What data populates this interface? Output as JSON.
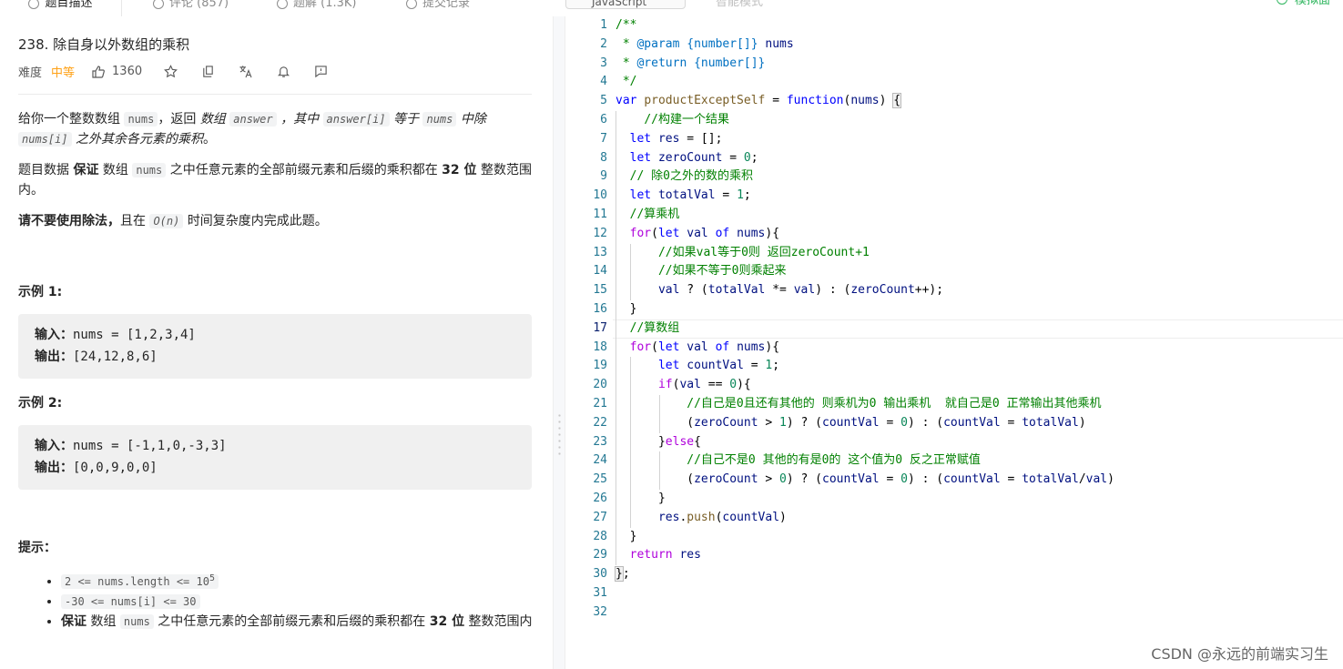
{
  "tabs": [
    {
      "label": "题目描述"
    },
    {
      "label": "评论 (857)"
    },
    {
      "label": "题解 (1.3K)"
    },
    {
      "label": "提交记录"
    }
  ],
  "editor_tabs": {
    "language": "JavaScript",
    "extra": "智能模式",
    "run_label": "模拟面"
  },
  "problem": {
    "title": "238. 除自身以外数组的乘积",
    "difficulty_label": "难度",
    "difficulty": "中等",
    "likes": "1360",
    "icons": [
      "thumbs-up-icon",
      "star-icon",
      "share-icon",
      "translate-icon",
      "bell-icon",
      "feedback-icon"
    ]
  },
  "description": {
    "p1": [
      "给你一个整数数组",
      "nums",
      "，返回",
      "数组",
      "answer",
      "，其中",
      "answer[i]",
      "等于",
      "nums",
      "中除",
      "nums[i]",
      "之外其余各元素的乘积",
      "。"
    ],
    "p2": [
      "题目数据",
      "保证",
      "数组",
      "nums",
      "之中任意元素的全部前缀元素和后缀的乘积都在",
      "32 位",
      "整数范围内。"
    ],
    "p3": [
      "请不要使用除法，",
      "且在",
      "O(n)",
      "时间复杂度内完成此题。"
    ]
  },
  "examples": [
    {
      "title": "示例 1:",
      "input_label": "输入：",
      "input": "nums = [1,2,3,4]",
      "output_label": "输出：",
      "output": "[24,12,8,6]"
    },
    {
      "title": "示例 2:",
      "input_label": "输入：",
      "input": "nums = [-1,1,0,-3,3]",
      "output_label": "输出：",
      "output": "[0,0,9,0,0]"
    }
  ],
  "hints": {
    "title": "提示：",
    "h1": "2 <= nums.length <= 10",
    "h1_sup": "5",
    "h2": "-30 <= nums[i] <= 30",
    "h3": [
      "保证",
      "数组",
      "nums",
      "之中任意元素的全部前缀元素和后缀的乘积都在",
      "32 位",
      "整数范围内"
    ]
  },
  "code": {
    "line_numbers": [
      "1",
      "2",
      "3",
      "4",
      "5",
      "6",
      "7",
      "8",
      "9",
      "10",
      "11",
      "12",
      "13",
      "14",
      "15",
      "16",
      "17",
      "18",
      "19",
      "20",
      "21",
      "22",
      "23",
      "24",
      "25",
      "26",
      "27",
      "28",
      "29",
      "30",
      "31",
      "32"
    ],
    "current_line": "17"
  },
  "watermark": "CSDN @永远的前端实习生"
}
